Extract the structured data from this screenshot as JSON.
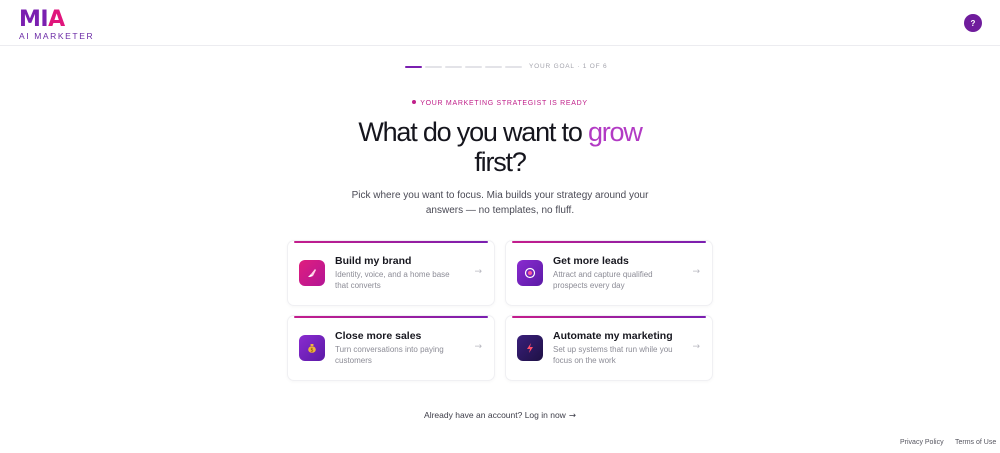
{
  "header": {
    "logo_word_m": "M",
    "logo_word_i": "I",
    "logo_word_a": "A",
    "logo_sub": "AI MARKETER",
    "help_label": "?"
  },
  "progress": {
    "current_step": 1,
    "total_steps": 6,
    "label": "YOUR GOAL · 1 OF 6"
  },
  "hero": {
    "badge": "YOUR MARKETING STRATEGIST IS READY",
    "title_part1": "What do you want to ",
    "title_accent": "grow",
    "title_part2": "first?",
    "subtitle": "Pick where you want to focus. Mia builds your strategy around your answers — no templates, no fluff."
  },
  "options": [
    {
      "title": "Build my brand",
      "description": "Identity, voice, and a home base that converts",
      "icon": "brush-icon"
    },
    {
      "title": "Get more leads",
      "description": "Attract and capture qualified prospects every day",
      "icon": "target-icon"
    },
    {
      "title": "Close more sales",
      "description": "Turn conversations into paying customers",
      "icon": "money-bag-icon"
    },
    {
      "title": "Automate my marketing",
      "description": "Set up systems that run while you focus on the work",
      "icon": "lightning-icon"
    }
  ],
  "footer": {
    "login_text": "Already have an account? Log in now",
    "privacy": "Privacy Policy",
    "terms": "Terms of Use"
  },
  "colors": {
    "brand_purple": "#7a1fb0",
    "brand_pink": "#e0157c",
    "accent_text": "#b23ac4"
  }
}
